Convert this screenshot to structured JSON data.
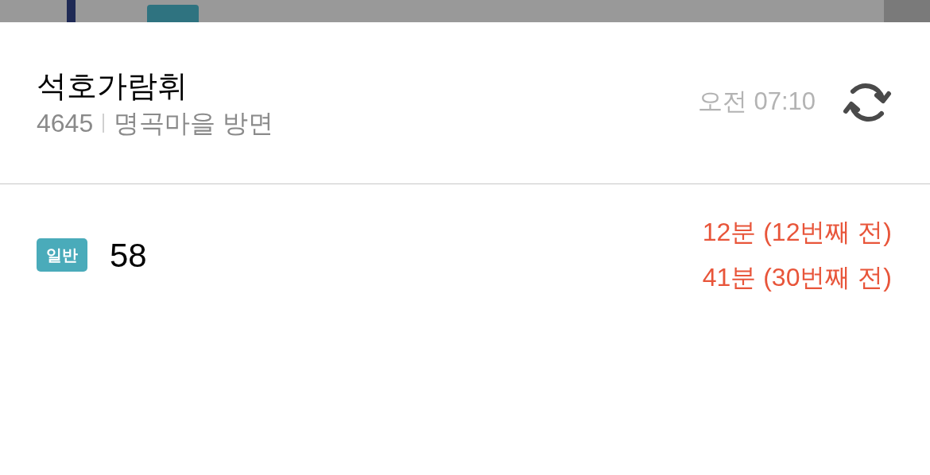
{
  "stop": {
    "name": "석호가람휘",
    "number": "4645",
    "direction": "명곡마을 방면",
    "updated": "오전 07:10"
  },
  "routes": [
    {
      "badge": "일반",
      "color": "#4aabba",
      "number": "58",
      "arrivals": [
        "12분 (12번째 전)",
        "41분 (30번째 전)"
      ]
    }
  ]
}
